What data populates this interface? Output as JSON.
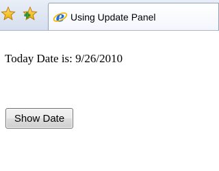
{
  "browser": {
    "favorites_icon": "favorites-star-icon",
    "add_favorites_icon": "add-favorites-icon",
    "tab": {
      "icon": "internet-explorer-icon",
      "title": "Using Update Panel"
    }
  },
  "page": {
    "date_label": "Today Date is: 9/26/2010",
    "button_label": "Show Date"
  },
  "colors": {
    "toolbar_bg": "#dde5f1",
    "star": "#f5b800",
    "add_plus": "#3aa335",
    "ie_blue": "#1f6fd1"
  }
}
